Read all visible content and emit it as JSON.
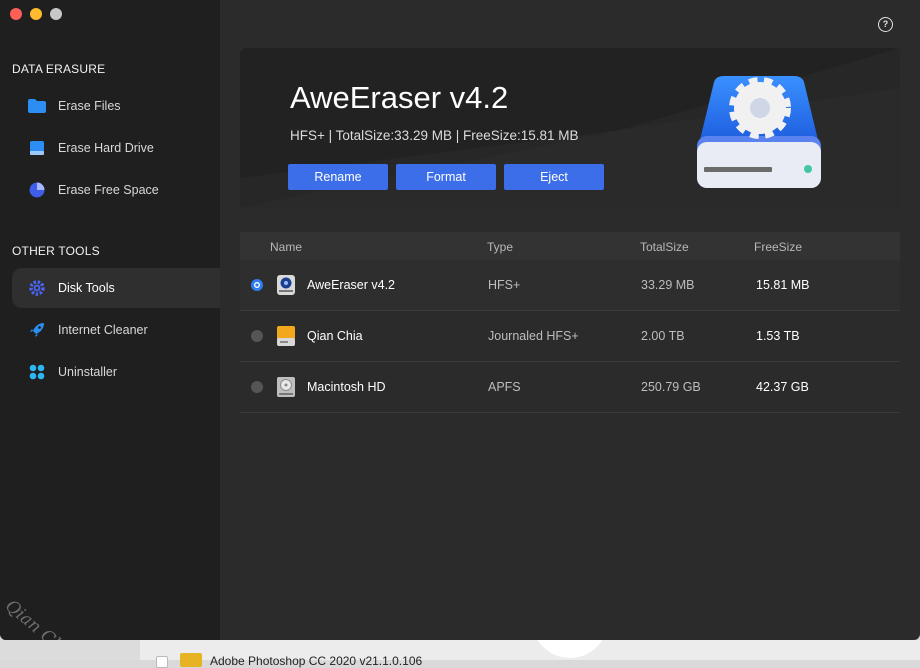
{
  "sidebar": {
    "section_data_erasure": "DATA ERASURE",
    "section_other_tools": "OTHER TOOLS",
    "items": [
      {
        "label": "Erase Files",
        "icon": "folder-icon"
      },
      {
        "label": "Erase Hard Drive",
        "icon": "hard-drive-icon"
      },
      {
        "label": "Erase Free Space",
        "icon": "pie-chart-icon"
      },
      {
        "label": "Disk Tools",
        "icon": "gear-icon",
        "active": true
      },
      {
        "label": "Internet Cleaner",
        "icon": "rocket-icon"
      },
      {
        "label": "Uninstaller",
        "icon": "apps-grid-icon"
      }
    ],
    "watermark": "Qian Chia Soft"
  },
  "header": {
    "help_symbol": "?"
  },
  "banner": {
    "title": "AweEraser v4.2",
    "subtitle": "HFS+ | TotalSize:33.29 MB | FreeSize:15.81 MB",
    "buttons": {
      "rename": "Rename",
      "format": "Format",
      "eject": "Eject"
    }
  },
  "table": {
    "columns": {
      "name": "Name",
      "type": "Type",
      "total": "TotalSize",
      "free": "FreeSize"
    },
    "rows": [
      {
        "name": "AweEraser v4.2",
        "type": "HFS+",
        "total": "33.29 MB",
        "free": "15.81 MB",
        "selected": true
      },
      {
        "name": "Qian Chia",
        "type": "Journaled HFS+",
        "total": "2.00 TB",
        "free": "1.53 TB",
        "selected": false
      },
      {
        "name": "Macintosh HD",
        "type": "APFS",
        "total": "250.79 GB",
        "free": "42.37 GB",
        "selected": false
      }
    ]
  },
  "background_window": {
    "row_text": "Adobe Photoshop CC 2020 v21.1.0.106"
  },
  "colors": {
    "accent": "#3d6ee9",
    "radio_selected": "#2f7ef0",
    "sidebar_bg": "#1f1f1f",
    "main_bg": "#2b2b2b"
  }
}
